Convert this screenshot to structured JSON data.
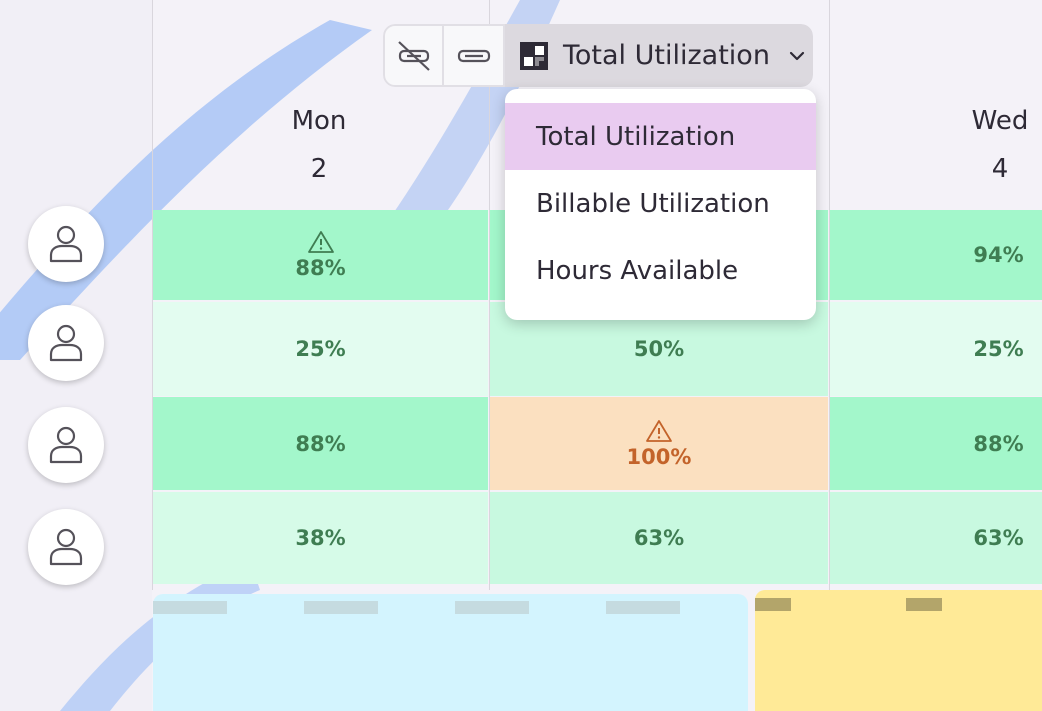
{
  "toolbar": {
    "hide_icon": "tag-off-icon",
    "compact_icon": "bar-icon",
    "metric_icon": "heatmap-icon",
    "metric_label": "Total Utilization",
    "chevron_icon": "chevron-down-icon"
  },
  "days": [
    {
      "name": "Mon",
      "date": "2"
    },
    {
      "name": "Wed",
      "date": "4"
    }
  ],
  "menu": {
    "items": [
      "Total Utilization",
      "Billable Utilization",
      "Hours Available"
    ],
    "selected": "Total Utilization"
  },
  "rows": [
    {
      "mon": "88%",
      "mon_warning": true,
      "wed": "94%"
    },
    {
      "mon": "25%",
      "tue": "50%",
      "wed": "25%"
    },
    {
      "mon": "88%",
      "tue": "100%",
      "tue_warning": true,
      "wed": "88%"
    },
    {
      "mon": "38%",
      "tue": "63%",
      "wed": "63%"
    }
  ],
  "colors": {
    "cell_dark_green": "#a3f7cb",
    "cell_light_green": "#e3fcf0",
    "cell_mid_green": "#c8f9e0",
    "cell_green_2": "#d6fbe8",
    "cell_orange": "#fbe0c0",
    "text_green": "#3f7d52",
    "text_orange": "#c3632a",
    "menu_selected": "#e9cbf0",
    "event_blue": "#d3f4fe",
    "event_yellow": "#ffea97"
  }
}
